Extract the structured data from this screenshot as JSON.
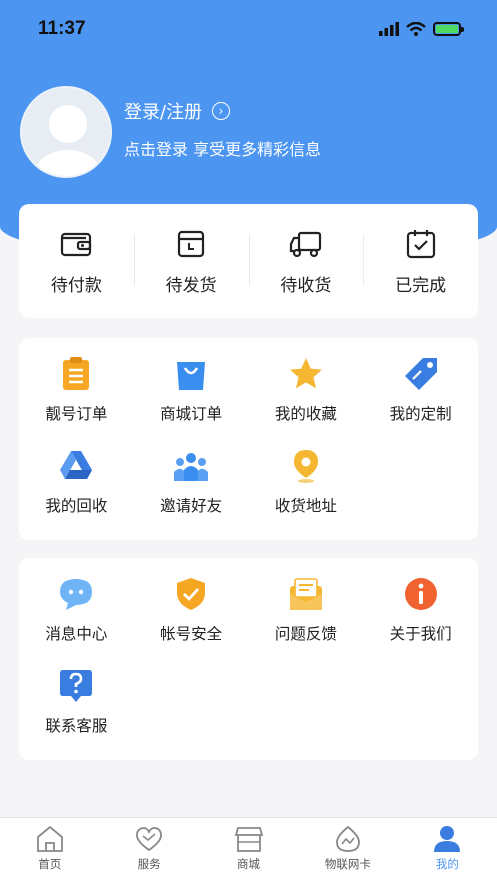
{
  "status_bar": {
    "time": "11:37"
  },
  "profile": {
    "login_label": "登录/注册",
    "subtitle": "点击登录 享受更多精彩信息"
  },
  "orders": [
    {
      "label": "待付款",
      "icon": "wallet-icon"
    },
    {
      "label": "待发货",
      "icon": "package-icon"
    },
    {
      "label": "待收货",
      "icon": "truck-icon"
    },
    {
      "label": "已完成",
      "icon": "calendar-check-icon"
    }
  ],
  "services": [
    {
      "label": "靓号订单",
      "icon": "clipboard-icon",
      "color": "#f5a623"
    },
    {
      "label": "商城订单",
      "icon": "shopping-bag-icon",
      "color": "#3a8ef0"
    },
    {
      "label": "我的收藏",
      "icon": "star-icon",
      "color": "#f5b731"
    },
    {
      "label": "我的定制",
      "icon": "tag-icon",
      "color": "#3a7de0"
    },
    {
      "label": "我的回收",
      "icon": "recycle-drive-icon",
      "color": "#3a7de0"
    },
    {
      "label": "邀请好友",
      "icon": "people-icon",
      "color": "#3a8ef0"
    },
    {
      "label": "收货地址",
      "icon": "location-pin-icon",
      "color": "#f5b731"
    }
  ],
  "tools": [
    {
      "label": "消息中心",
      "icon": "chat-bubble-icon",
      "color": "#5aaaf5"
    },
    {
      "label": "帐号安全",
      "icon": "shield-check-icon",
      "color": "#f5a623"
    },
    {
      "label": "问题反馈",
      "icon": "feedback-envelope-icon",
      "color": "#f5b731"
    },
    {
      "label": "关于我们",
      "icon": "info-icon",
      "color": "#f06230"
    },
    {
      "label": "联系客服",
      "icon": "question-icon",
      "color": "#3a7de0"
    }
  ],
  "tabbar": [
    {
      "label": "首页",
      "icon": "home-icon"
    },
    {
      "label": "服务",
      "icon": "heart-icon"
    },
    {
      "label": "商城",
      "icon": "store-icon"
    },
    {
      "label": "物联网卡",
      "icon": "iot-card-icon"
    },
    {
      "label": "我的",
      "icon": "profile-icon",
      "active": true
    }
  ],
  "colors": {
    "brand": "#4c96f2",
    "background": "#f5f5f7"
  }
}
